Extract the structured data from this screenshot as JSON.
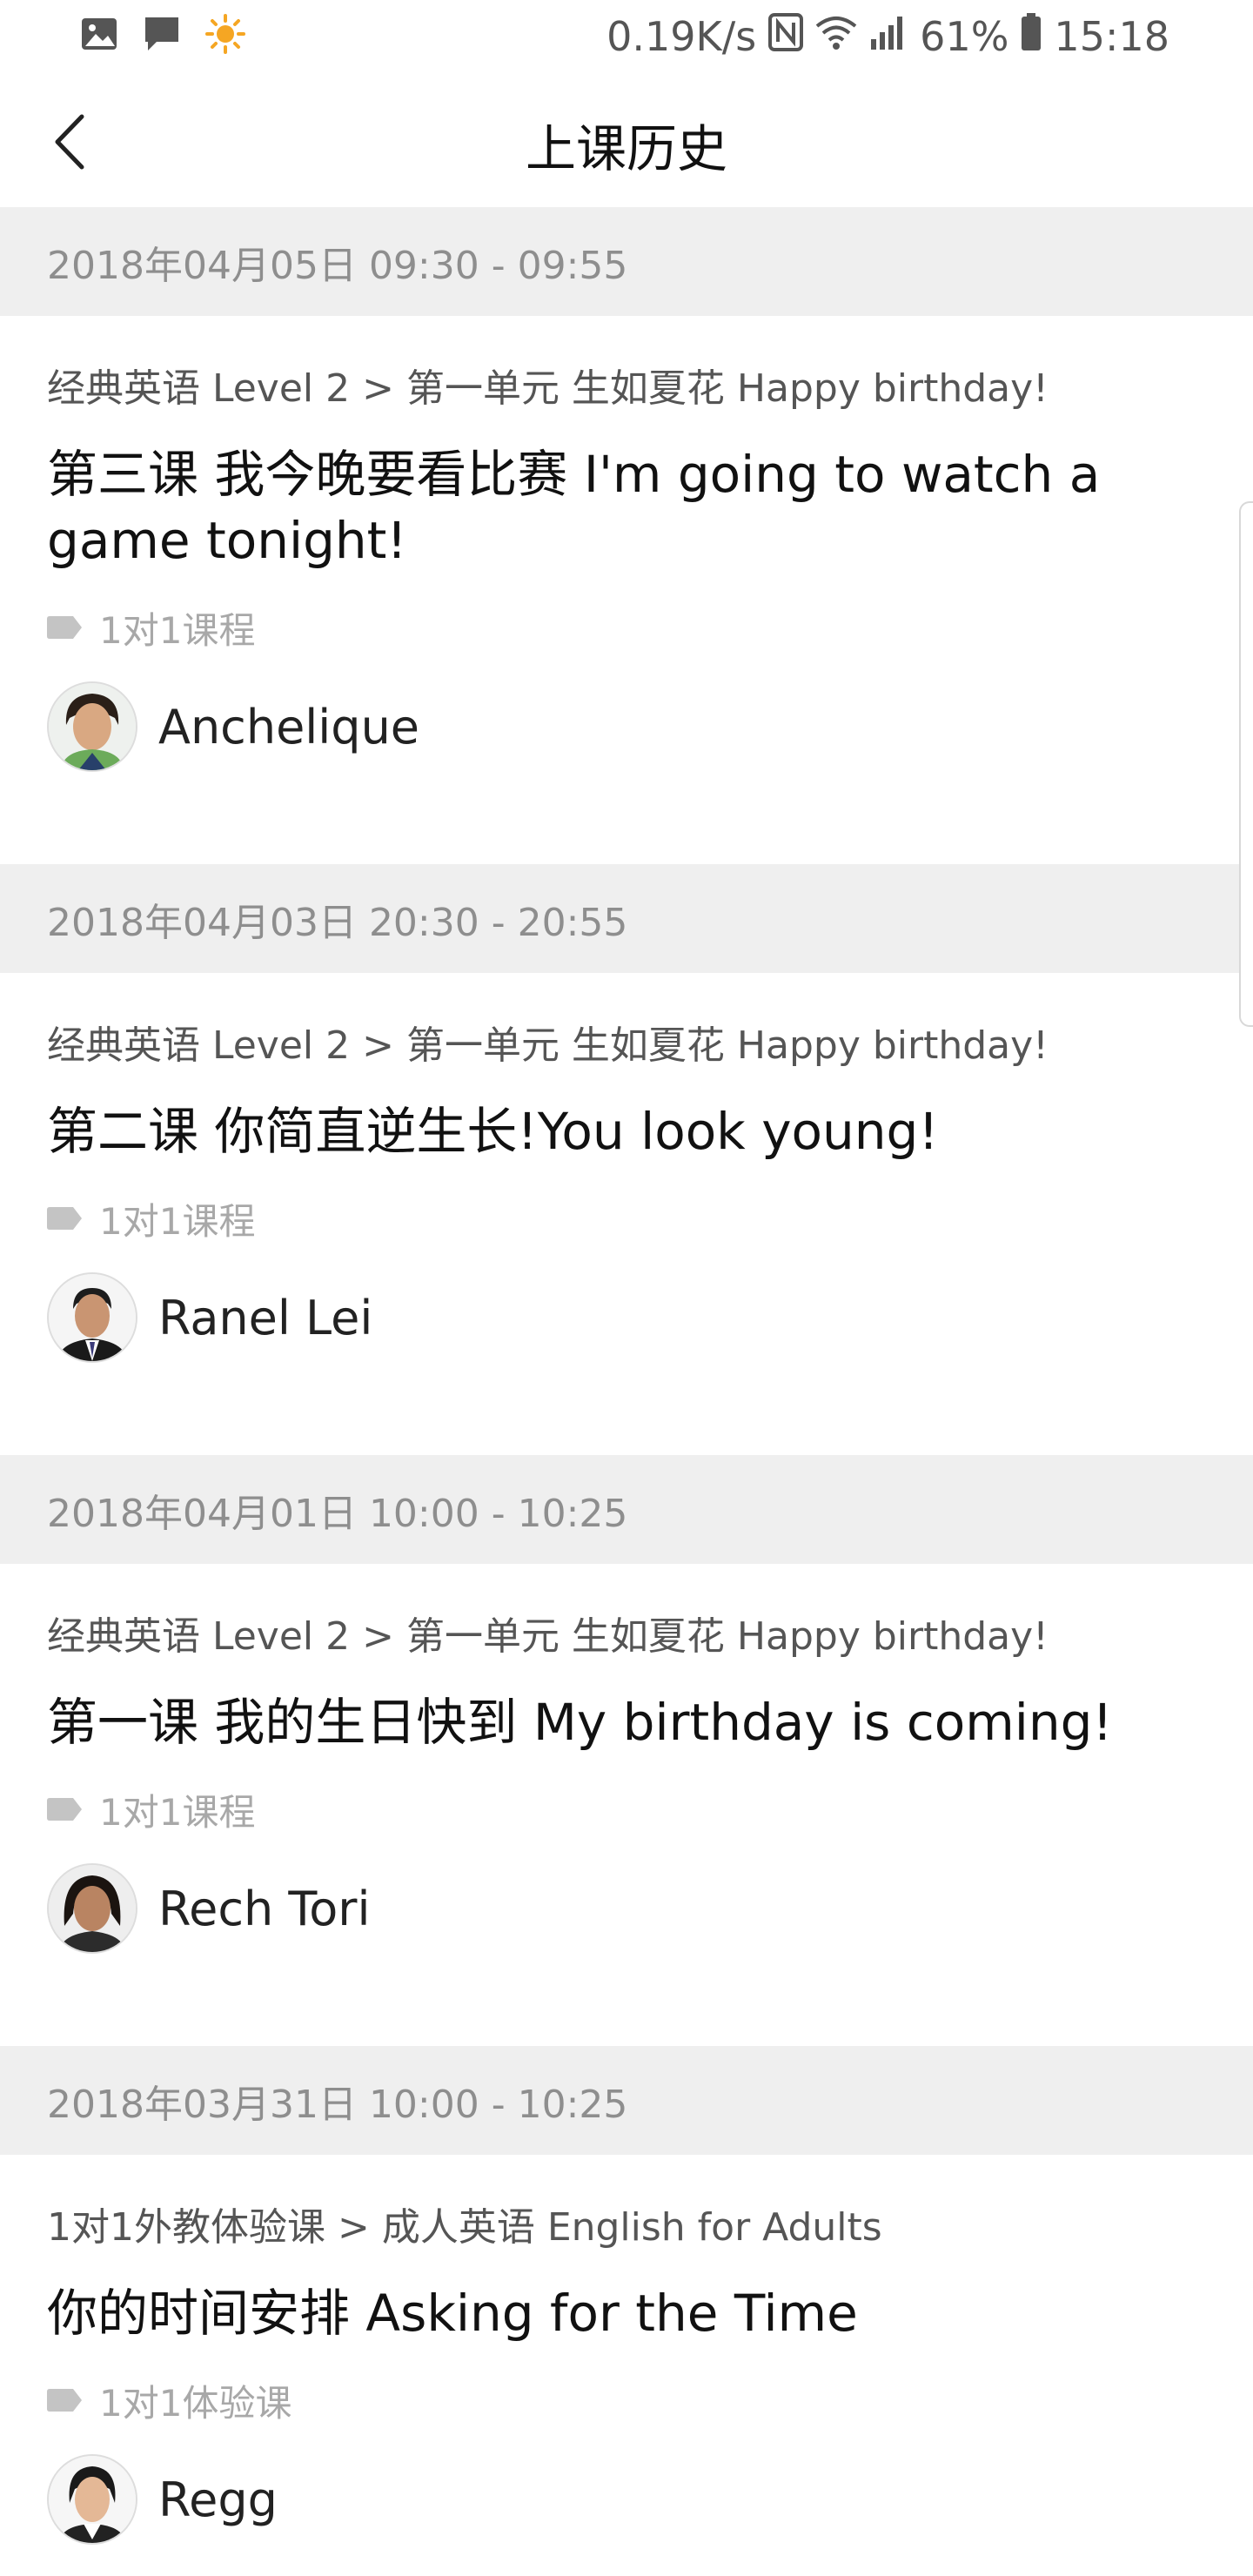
{
  "status_bar": {
    "network_speed": "0.19K/s",
    "battery": "61%",
    "time": "15:18",
    "left_icons": [
      "gallery-icon",
      "message-icon",
      "weather-sun-icon"
    ],
    "right_icons": [
      "nfc-icon",
      "wifi-icon",
      "signal-icon",
      "battery-icon"
    ]
  },
  "header": {
    "title": "上课历史",
    "back_icon": "chevron-left-icon"
  },
  "colors": {
    "date_bar_bg": "#efefef",
    "date_text": "#8e8e8e",
    "path_text": "#555555",
    "tag_text": "#a8a8a8",
    "sun": "#f5a623"
  },
  "lessons": [
    {
      "date": "2018年04月05日 09:30 - 09:55",
      "path": "经典英语 Level 2 > 第一单元 生如夏花 Happy birthday!",
      "title": "第三课 我今晚要看比赛 I'm going to watch a game tonight!",
      "tag": "1对1课程",
      "teacher": "Anchelique"
    },
    {
      "date": "2018年04月03日 20:30 - 20:55",
      "path": "经典英语 Level 2 > 第一单元 生如夏花 Happy birthday!",
      "title": "第二课 你简直逆生长!You look young!",
      "tag": "1对1课程",
      "teacher": "Ranel Lei"
    },
    {
      "date": "2018年04月01日 10:00 - 10:25",
      "path": "经典英语 Level 2 > 第一单元 生如夏花 Happy birthday!",
      "title": "第一课 我的生日快到  My birthday is coming!",
      "tag": "1对1课程",
      "teacher": "Rech Tori"
    },
    {
      "date": "2018年03月31日 10:00 - 10:25",
      "path": "1对1外教体验课 > 成人英语 English for Adults",
      "title": "你的时间安排 Asking for the Time",
      "tag": "1对1体验课",
      "teacher": "Regg"
    }
  ]
}
